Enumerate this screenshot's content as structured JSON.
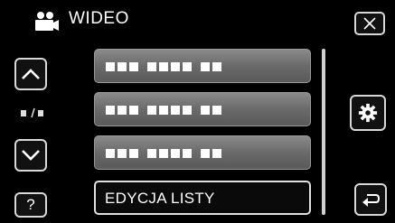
{
  "header": {
    "title": "WIDEO",
    "mode_icon": "video-camera-icon"
  },
  "buttons": {
    "close_icon": "close-icon",
    "up_icon": "chevron-up-icon",
    "down_icon": "chevron-down-icon",
    "help_label": "?",
    "settings_icon": "gear-icon",
    "back_icon": "return-icon"
  },
  "page_indicator": {
    "text": "▪/▪"
  },
  "menu": {
    "items": [
      {
        "label": "",
        "placeholder_icon": "garbled-text-blocks"
      },
      {
        "label": "",
        "placeholder_icon": "garbled-text-blocks"
      },
      {
        "label": "",
        "placeholder_icon": "garbled-text-blocks"
      },
      {
        "label": "EDYCJA LISTY"
      }
    ]
  },
  "colors": {
    "item_fill": "#6e6e6e",
    "border": "#d8d8d8",
    "background": "#000000"
  }
}
